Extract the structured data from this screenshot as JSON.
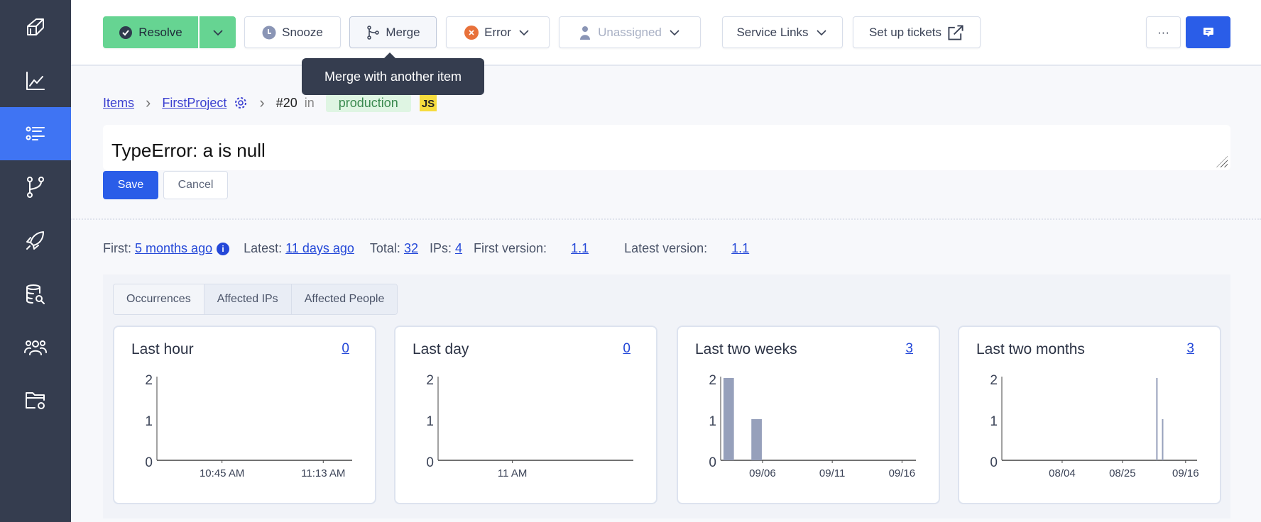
{
  "sidebar": {
    "items": [
      {
        "icon": "cube-logo-icon"
      },
      {
        "icon": "chart-line-icon"
      },
      {
        "icon": "items-list-icon",
        "active": true
      },
      {
        "icon": "git-branch-icon"
      },
      {
        "icon": "rocket-icon"
      },
      {
        "icon": "database-search-icon"
      },
      {
        "icon": "people-icon"
      },
      {
        "icon": "folder-settings-icon"
      }
    ]
  },
  "toolbar": {
    "resolve": "Resolve",
    "snooze": "Snooze",
    "merge": "Merge",
    "level": "Error",
    "assignee": "Unassigned",
    "service_links": "Service Links",
    "tickets": "Set up tickets",
    "more": "···"
  },
  "tooltip": "Merge with another item",
  "breadcrumb": {
    "items": "Items",
    "project": "FirstProject",
    "item_number": "#20",
    "in": "in",
    "environment": "production",
    "language": "JS"
  },
  "title_value": "TypeError: a is null",
  "buttons": {
    "save": "Save",
    "cancel": "Cancel"
  },
  "stats": {
    "first_label": "First:",
    "first_value": "5 months ago",
    "latest_label": "Latest:",
    "latest_value": "11 days ago",
    "total_label": "Total:",
    "total_value": "32",
    "ips_label": "IPs:",
    "ips_value": "4",
    "first_version_label": "First version:",
    "first_version_value": "1.1",
    "latest_version_label": "Latest version:",
    "latest_version_value": "1.1"
  },
  "tabs": [
    "Occurrences",
    "Affected IPs",
    "Affected People"
  ],
  "colors": {
    "sidebar": "#353d4f",
    "active": "#3f74f3",
    "resolve": "#66d492",
    "primary": "#2a5de8",
    "bar": "#96a0bb"
  },
  "chart_data": [
    {
      "type": "bar",
      "title": "Last hour",
      "count": "0",
      "xkind": "time",
      "xlim": [
        "10:27 AM",
        "11:21 AM"
      ],
      "xticks": [
        "10:45 AM",
        "11:13 AM"
      ],
      "ylim": [
        0,
        2
      ],
      "yticks": [
        "0",
        "1",
        "2"
      ],
      "points": []
    },
    {
      "type": "bar",
      "title": "Last day",
      "count": "0",
      "xkind": "time",
      "xlim": [
        "9:34 AM",
        "1:20 PM"
      ],
      "xticks": [
        "6 PM",
        "2 AM",
        "11 AM"
      ],
      "ylim": [
        0,
        2
      ],
      "yticks": [
        "0",
        "1",
        "2"
      ],
      "points": []
    },
    {
      "type": "bar",
      "title": "Last two weeks",
      "count": "3",
      "xkind": "date",
      "xlim": [
        "09/03",
        "09/17"
      ],
      "xticks": [
        "09/06",
        "09/11",
        "09/16"
      ],
      "ylim": [
        0,
        2
      ],
      "yticks": [
        "0",
        "1",
        "2"
      ],
      "points": [
        [
          "09/03",
          2
        ],
        [
          "09/05",
          1
        ]
      ]
    },
    {
      "type": "bar",
      "title": "Last two months",
      "count": "3",
      "xkind": "date",
      "xlim": [
        "07/14",
        "09/20"
      ],
      "xticks": [
        "08/04",
        "08/25",
        "09/16"
      ],
      "ylim": [
        0,
        2
      ],
      "yticks": [
        "0",
        "1",
        "2"
      ],
      "points": [
        [
          "09/06",
          2
        ],
        [
          "09/08",
          1
        ]
      ],
      "thin": true
    }
  ]
}
